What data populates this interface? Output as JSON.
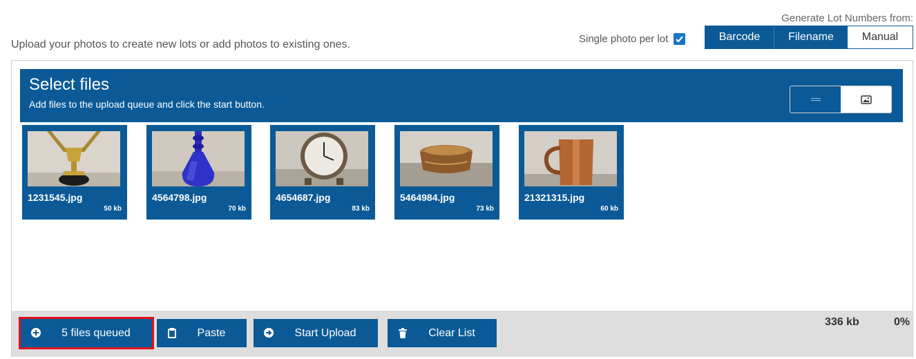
{
  "intro_text": "Upload your photos to create new lots or add photos to existing ones.",
  "generate_label": "Generate Lot Numbers from:",
  "single_photo_label": "Single photo per lot",
  "single_photo_checked": true,
  "lot_source_options": [
    "Barcode",
    "Filename",
    "Manual"
  ],
  "lot_source_selected": [
    "Barcode",
    "Filename"
  ],
  "uploader": {
    "title": "Select files",
    "subtitle": "Add files to the upload queue and click the start button.",
    "view_modes": [
      "list-view-icon",
      "thumbnail-view-icon"
    ],
    "active_view": "list-view-icon"
  },
  "files": [
    {
      "name": "1231545.jpg",
      "size": "50 kb",
      "icon": "trophy"
    },
    {
      "name": "4564798.jpg",
      "size": "70 kb",
      "icon": "blue-vase"
    },
    {
      "name": "4654687.jpg",
      "size": "83 kb",
      "icon": "alarm-clock"
    },
    {
      "name": "5464984.jpg",
      "size": "73 kb",
      "icon": "trinket-box"
    },
    {
      "name": "21321315.jpg",
      "size": "60 kb",
      "icon": "copper-mug"
    }
  ],
  "footer": {
    "queued_label": "5 files queued",
    "paste_label": "Paste",
    "start_label": "Start Upload",
    "clear_label": "Clear List",
    "total_size": "336 kb",
    "progress": "0%"
  },
  "colors": {
    "primary": "#0b5a97",
    "highlight": "#e0101c",
    "footer_bg": "#dedede"
  }
}
